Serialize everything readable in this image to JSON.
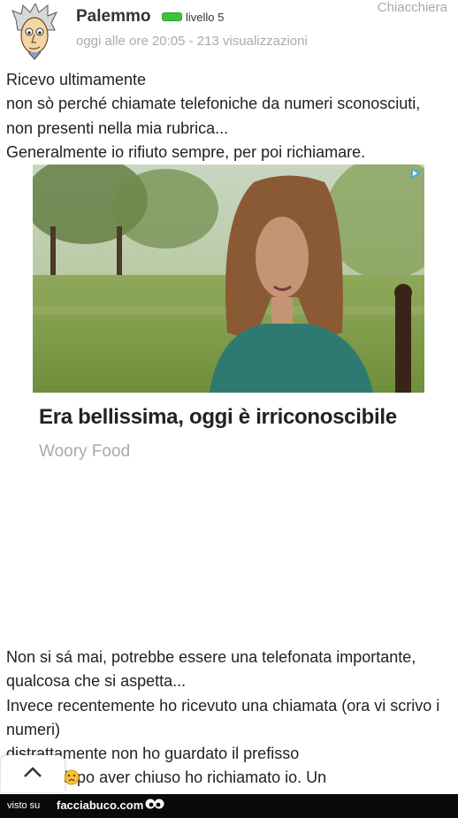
{
  "header": {
    "username": "Palemmo",
    "level": "livello 5",
    "category": "Chiacchiera",
    "meta": "oggi alle ore 20:05 - 213 visualizzazioni"
  },
  "post": {
    "intro": "Ricevo ultimamente\nnon sò perché chiamate telefoniche da numeri sconosciuti, non presenti nella mia rubrica...\nGeneralmente io rifiuto sempre, per poi richiamare.",
    "continued": "Non si sá mai, potrebbe essere una telefonata importante, qualcosa che si aspetta...\nInvece recentemente ho ricevuto una chiamata (ora vi scrivo i numeri)\ndistrattamente non ho guardato il prefisso\n         e dopo aver chiuso ho richiamato io. Un"
  },
  "ad": {
    "headline": "Era bellissima, oggi è irriconoscibile",
    "source": "Woory Food",
    "badge_icon": "ad-choices-icon"
  },
  "footer": {
    "visto_su": "visto su",
    "brand": "facciabuco.com"
  },
  "colors": {
    "level_green": "#3cc43c",
    "footer_bg": "#0a0a0a",
    "muted": "#aaaaaa"
  }
}
